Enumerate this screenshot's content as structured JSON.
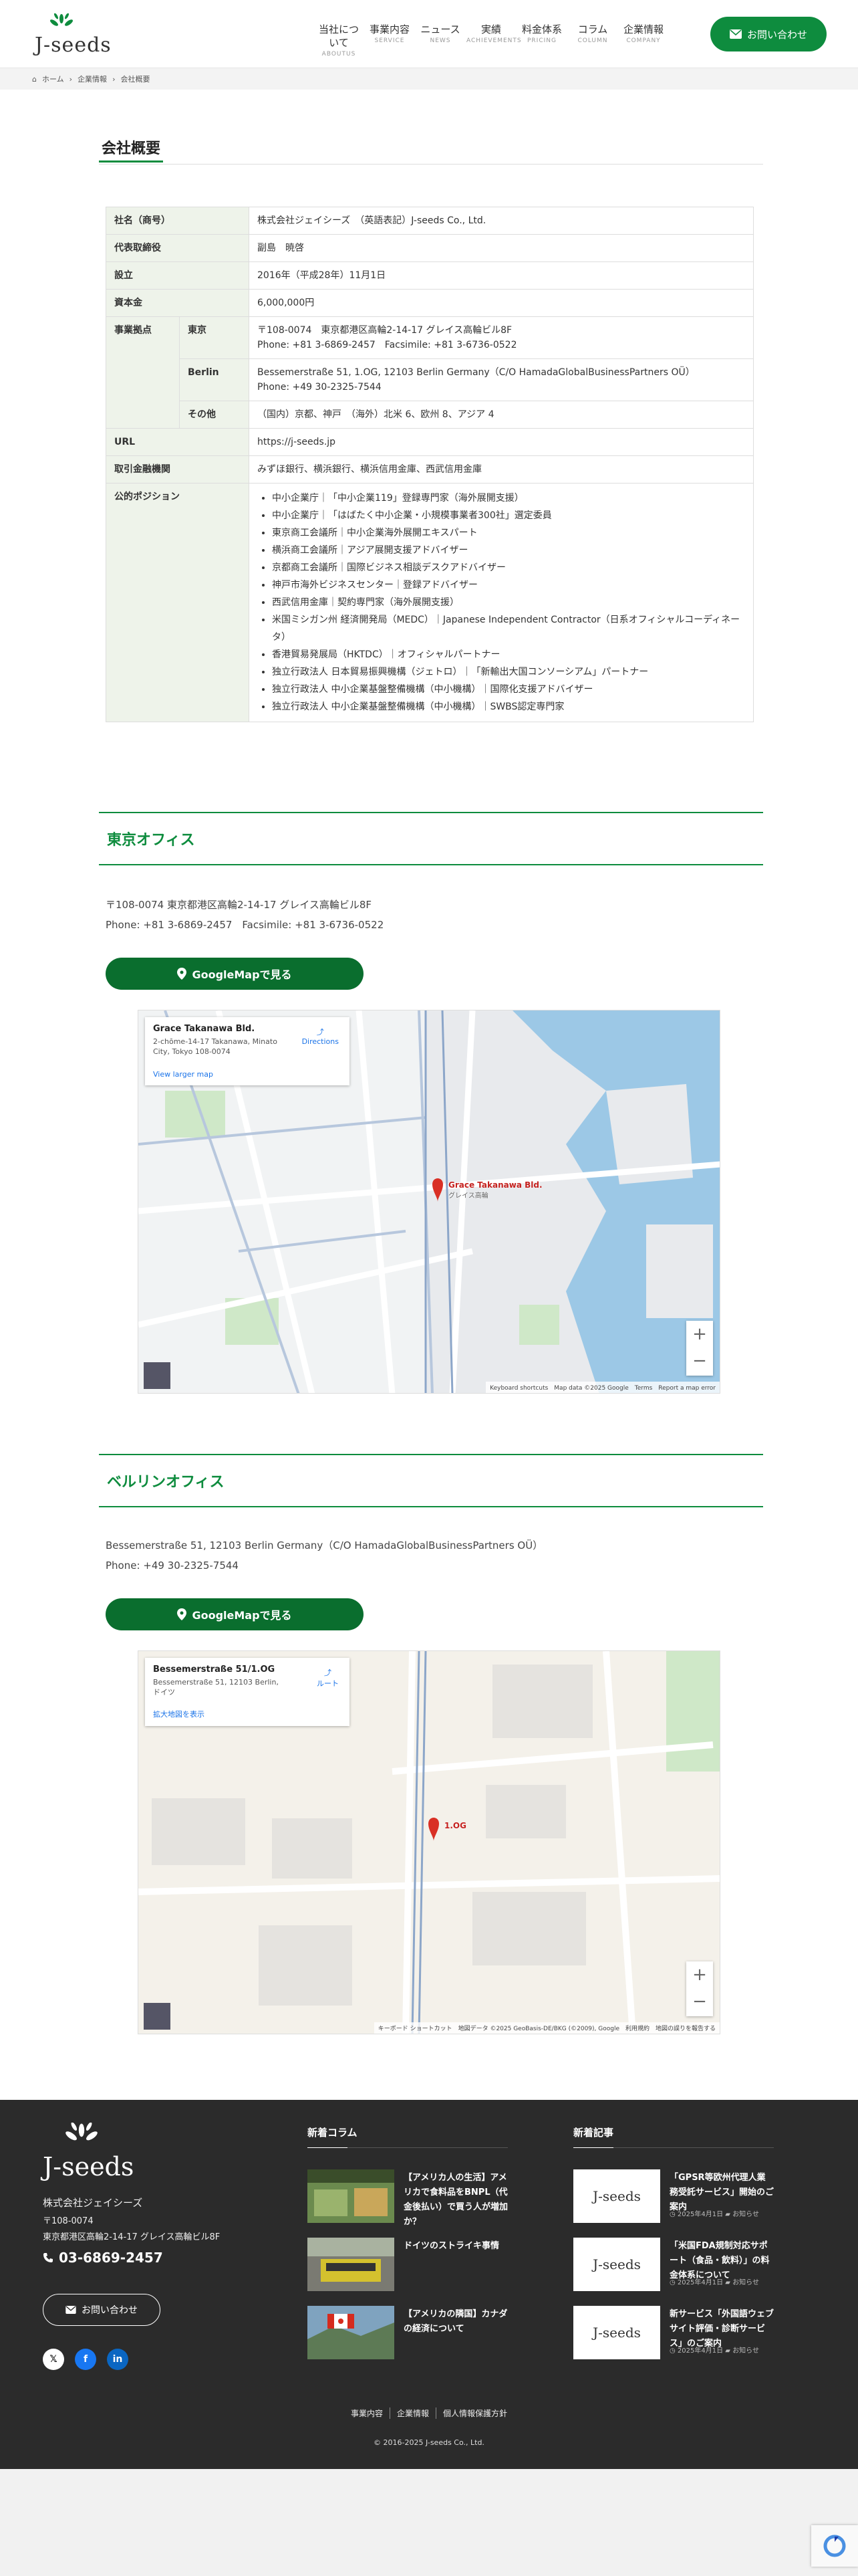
{
  "header": {
    "logo_text": "J-seeds",
    "nav": [
      {
        "jp": "当社について",
        "en": "ABOUTUS"
      },
      {
        "jp": "事業内容",
        "en": "SERVICE"
      },
      {
        "jp": "ニュース",
        "en": "NEWS"
      },
      {
        "jp": "実績",
        "en": "ACHIEVEMENTS"
      },
      {
        "jp": "料金体系",
        "en": "PRICING"
      },
      {
        "jp": "コラム",
        "en": "COLUMN"
      },
      {
        "jp": "企業情報",
        "en": "COMPANY"
      }
    ],
    "contact_label": "お問い合わせ"
  },
  "breadcrumb": {
    "home": "ホーム",
    "parent": "企業情報",
    "current": "会社概要"
  },
  "page_title": "会社概要",
  "info": {
    "name_h": "社名（商号）",
    "name_v": "株式会社ジェイシーズ　（英語表記）J-seeds Co., Ltd.",
    "ceo_h": "代表取締役",
    "ceo_v": "副島　暁啓",
    "est_h": "設立",
    "est_v": "2016年（平成28年）11月1日",
    "cap_h": "資本金",
    "cap_v": "6,000,000円",
    "base_h": "事業拠点",
    "tokyo_h": "東京",
    "tokyo_v1": "〒108-0074　東京都港区高輪2-14-17 グレイス高輪ビル8F",
    "tokyo_v2": "Phone: +81 3-6869-2457　Facsimile: +81 3-6736-0522",
    "berlin_h": "Berlin",
    "berlin_v1": "Bessemerstraße 51, 1.OG, 12103 Berlin Germany（C/O HamadaGlobalBusinessPartners OÜ）",
    "berlin_v2": "Phone: +49 30-2325-7544",
    "other_h": "その他",
    "other_v": "（国内）京都、神戸　（海外）北米 6、欧州 8、アジア 4",
    "url_h": "URL",
    "url_v": "https://j-seeds.jp",
    "bank_h": "取引金融機関",
    "bank_v": "みずほ銀行、横浜銀行、横浜信用金庫、西武信用金庫",
    "pos_h": "公的ポジション",
    "positions": [
      "中小企業庁｜「中小企業119」登録専門家（海外展開支援）",
      "中小企業庁｜「はばたく中小企業・小規模事業者300社」選定委員",
      "東京商工会議所｜中小企業海外展開エキスパート",
      "横浜商工会議所｜アジア展開支援アドバイザー",
      "京都商工会議所｜国際ビジネス相談デスクアドバイザー",
      "神戸市海外ビジネスセンター｜登録アドバイザー",
      "西武信用金庫｜契約専門家（海外展開支援）",
      "米国ミシガン州 経済開発局（MEDC）｜Japanese Independent Contractor（日系オフィシャルコーディネータ）",
      "香港貿易発展局（HKTDC）｜オフィシャルパートナー",
      "独立行政法人 日本貿易振興機構（ジェトロ）｜「新輸出大国コンソーシアム」パートナー",
      "独立行政法人 中小企業基盤整備機構（中小機構）｜国際化支援アドバイザー",
      "独立行政法人 中小企業基盤整備機構（中小機構）｜SWBS認定専門家"
    ]
  },
  "tokyo": {
    "title": "東京オフィス",
    "addr1": "〒108-0074 東京都港区高輪2-14-17 グレイス高輪ビル8F",
    "addr2": "Phone: +81 3-6869-2457　Facsimile: +81 3-6736-0522",
    "btn": "GoogleMapで見る",
    "map": {
      "card_title": "Grace Takanawa Bld.",
      "card_addr": "2-chōme-14-17 Takanawa, Minato City, Tokyo 108-0074",
      "card_link": "View larger map",
      "directions": "Directions",
      "pin": "Grace Takanawa Bld.",
      "pin_sub": "グレイス高輪",
      "footer": "Keyboard shortcuts　Map data ©2025 Google　Terms　Report a map error"
    }
  },
  "berlin": {
    "title": "ベルリンオフィス",
    "addr1": "Bessemerstraße 51, 12103 Berlin Germany（C/O HamadaGlobalBusinessPartners OÜ）",
    "addr2": "Phone: +49 30-2325-7544",
    "btn": "GoogleMapで見る",
    "map": {
      "card_title": "Bessemerstraße 51/1.OG",
      "card_addr": "Bessemerstraße 51, 12103 Berlin, ドイツ",
      "card_link": "拡大地図を表示",
      "directions": "ルート",
      "pin": "1.OG",
      "footer": "キーボード ショートカット　地図データ ©2025 GeoBasis-DE/BKG (©2009), Google　利用規約　地図の誤りを報告する"
    }
  },
  "footer": {
    "logo_text": "J-seeds",
    "company": "株式会社ジェイシーズ",
    "zip": "〒108-0074",
    "address": "東京都港区高輪2-14-17 グレイス高輪ビル8F",
    "phone": "03-6869-2457",
    "contact": "お問い合わせ",
    "col_title": "新着コラム",
    "columns": [
      {
        "title": "【アメリカ人の生活】アメリカで食料品をBNPL（代金後払い）で買う人が増加か？"
      },
      {
        "title": "ドイツのストライキ事情"
      },
      {
        "title": "【アメリカの隣国】カナダの経済について"
      }
    ],
    "news_title": "新着記事",
    "news": [
      {
        "title": "「GPSR等欧州代理人業務受託サービス」開始のご案内",
        "date": "2025年4月1日",
        "cat": "お知らせ"
      },
      {
        "title": "「米国FDA規制対応サポート（食品・飲料）」の料金体系について",
        "date": "2025年4月1日",
        "cat": "お知らせ"
      },
      {
        "title": "新サービス「外国語ウェブサイト評価・診断サービス」のご案内",
        "date": "2025年4月1日",
        "cat": "お知らせ"
      }
    ],
    "links": [
      "事業内容",
      "企業情報",
      "個人情報保護方針"
    ],
    "copyright": "© 2016-2025 J-seeds Co., Ltd."
  },
  "colors": {
    "brand_green": "#0e8c3e",
    "dark_green": "#0a6e2e",
    "footer_bg": "#2b2b2b",
    "table_head": "#eef3ea"
  }
}
